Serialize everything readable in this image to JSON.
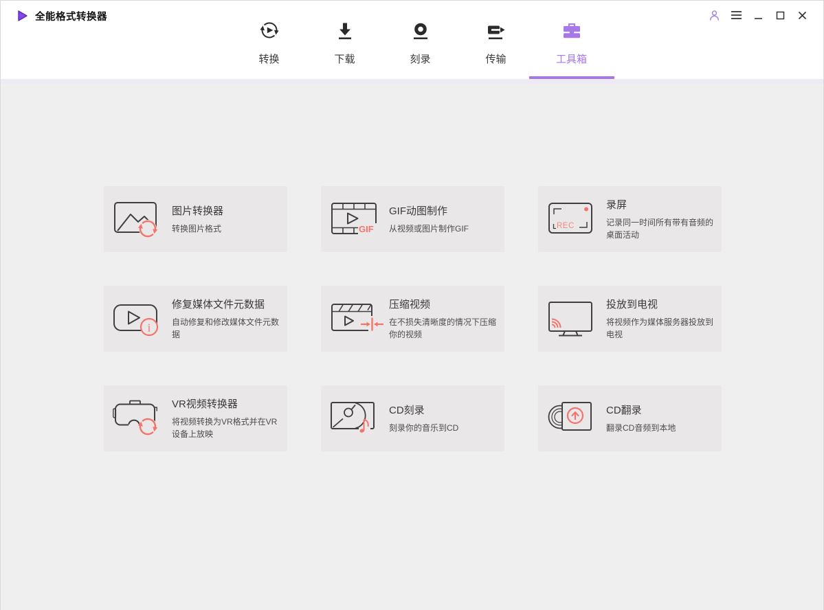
{
  "app": {
    "title": "全能格式转换器",
    "logo_icon": "play-logo-icon"
  },
  "titlebar": {
    "controls": [
      {
        "icon": "account-icon"
      },
      {
        "icon": "menu-icon"
      },
      {
        "icon": "minimize-icon"
      },
      {
        "icon": "maximize-icon"
      },
      {
        "icon": "close-icon"
      }
    ]
  },
  "nav": {
    "tabs": [
      {
        "label": "转换",
        "icon": "convert-icon",
        "active": false
      },
      {
        "label": "下载",
        "icon": "download-icon",
        "active": false
      },
      {
        "label": "刻录",
        "icon": "burn-icon",
        "active": false
      },
      {
        "label": "传输",
        "icon": "transfer-icon",
        "active": false
      },
      {
        "label": "工具箱",
        "icon": "toolbox-icon",
        "active": true
      }
    ]
  },
  "toolbox": {
    "cards": [
      {
        "title": "图片转换器",
        "desc": "转换图片格式",
        "icon": "image-converter-icon"
      },
      {
        "title": "GIF动图制作",
        "desc": "从视频或图片制作GIF",
        "icon": "gif-maker-icon",
        "badge": "GIF"
      },
      {
        "title": "录屏",
        "desc": "记录同一时间所有带有音频的桌面活动",
        "icon": "screen-recorder-icon",
        "badge": "REC"
      },
      {
        "title": "修复媒体文件元数据",
        "desc": "自动修复和修改媒体文件元数据",
        "icon": "fix-metadata-icon",
        "badge": "i"
      },
      {
        "title": "压缩视频",
        "desc": "在不损失清晰度的情况下压缩你的视频",
        "icon": "compress-video-icon"
      },
      {
        "title": "投放到电视",
        "desc": "将视频作为媒体服务器投放到电视",
        "icon": "cast-to-tv-icon"
      },
      {
        "title": "VR视频转换器",
        "desc": "将视频转换为VR格式并在VR设备上放映",
        "icon": "vr-converter-icon"
      },
      {
        "title": "CD刻录",
        "desc": "刻录你的音乐到CD",
        "icon": "cd-burn-icon"
      },
      {
        "title": "CD翻录",
        "desc": "翻录CD音频到本地",
        "icon": "cd-rip-icon"
      }
    ]
  },
  "colors": {
    "accent_purple": "#a678e8",
    "logo_purple": "#8347e5",
    "accent_coral": "#f4746c",
    "header_bg": "#ffffff",
    "content_bg": "#f0eff0",
    "card_bg": "#e9e7e8",
    "icon_dark": "#3f3f3f"
  }
}
